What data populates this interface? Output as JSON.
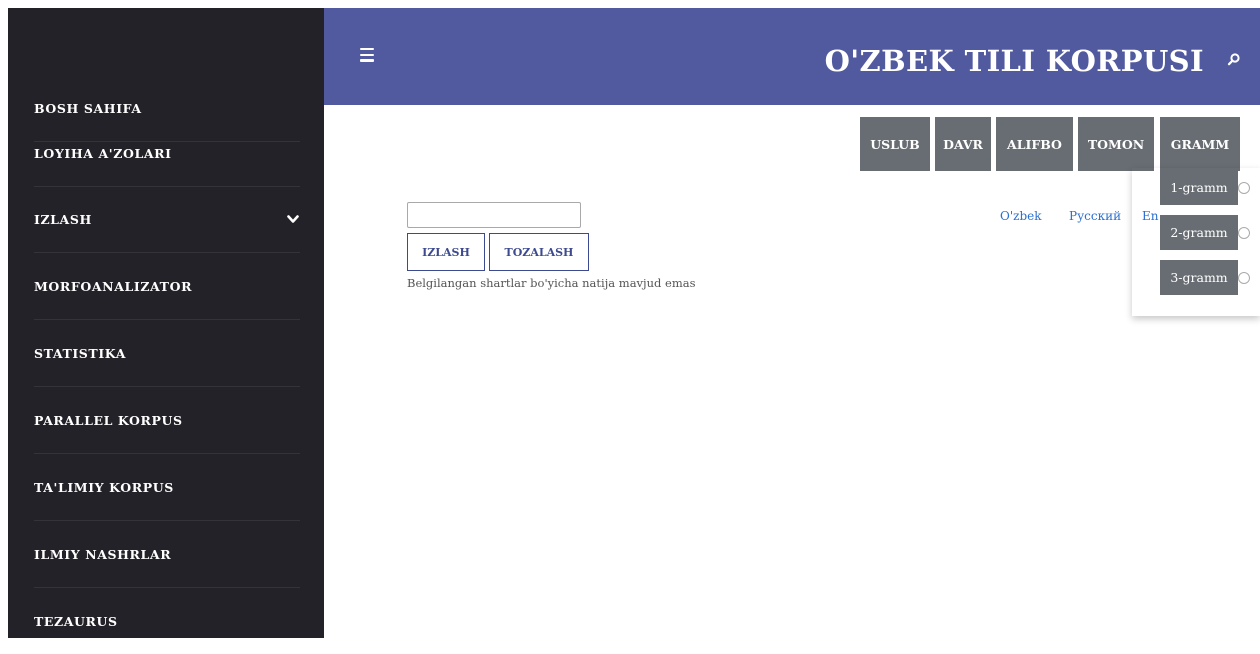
{
  "sidebar": {
    "items": [
      {
        "label": "BOSH SAHIFA"
      },
      {
        "label": "LOYIHA A'ZOLARI"
      },
      {
        "label": "IZLASH",
        "has_dropdown": true
      },
      {
        "label": "MORFOANALIZATOR"
      },
      {
        "label": "STATISTIKA"
      },
      {
        "label": "PARALLEL KORPUS"
      },
      {
        "label": "TA'LIMIY KORPUS"
      },
      {
        "label": "ILMIY NASHRLAR"
      },
      {
        "label": "TEZAURUS"
      }
    ],
    "background": "#222228"
  },
  "header": {
    "title": "O'ZBEK TILI KORPUSI",
    "menu_icon": "hamburger-icon",
    "search_icon": "search-icon",
    "background": "#515a9e"
  },
  "filters": {
    "buttons": [
      "USLUB",
      "DAVR",
      "ALIFBO",
      "TOMON",
      "GRAMM"
    ],
    "gram_options": [
      "1-gramm",
      "2-gramm",
      "3-gramm"
    ],
    "button_color": "#686d73"
  },
  "search": {
    "input_value": "",
    "search_button": "IZLASH",
    "clear_button": "TOZALASH",
    "result_text": "Belgilangan shartlar bo'yicha natija mavjud emas"
  },
  "languages": [
    "O'zbek",
    "Русский",
    "En"
  ],
  "colors": {
    "link": "#2a6fd1",
    "form_border": "#3e4a8f"
  }
}
